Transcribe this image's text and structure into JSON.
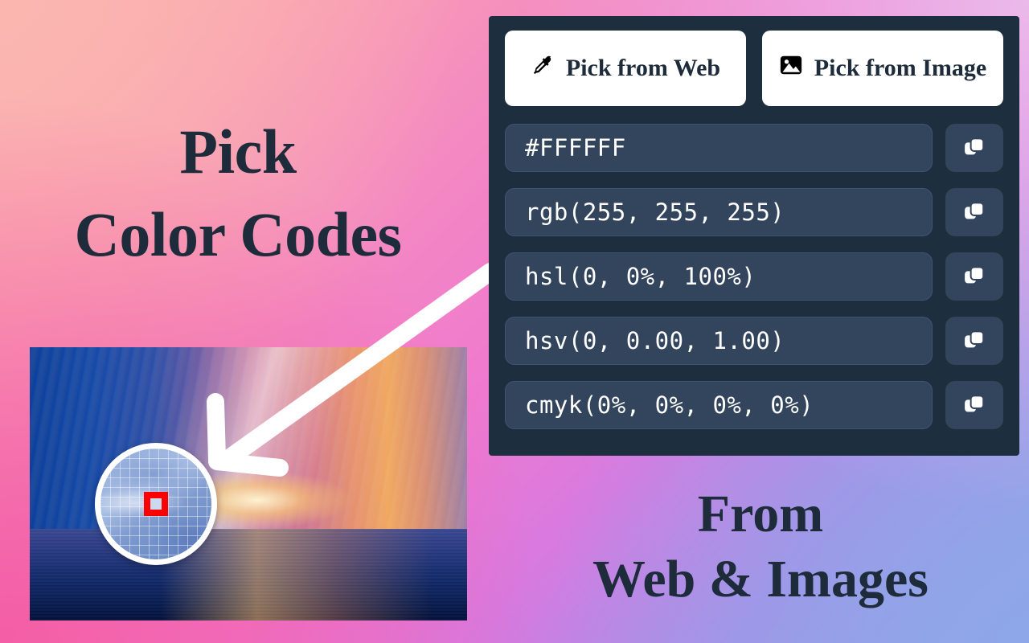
{
  "background": {
    "gradient_colors": [
      "#FBB6B0",
      "#ECBDEB",
      "#F45BA4",
      "#8EA7E8"
    ]
  },
  "headline": {
    "line1": "Pick",
    "line2": "Color Codes",
    "color": "#1D2B3A"
  },
  "tagline": {
    "line1": "From",
    "line2": "Web & Images",
    "color": "#1D2B3A"
  },
  "photo": {
    "alt": "sunset over ocean photograph"
  },
  "magnifier": {
    "target_outline_color": "#FF0000",
    "sampled_color": "#CCD9EF",
    "ring_color": "#FFFFFF"
  },
  "panel": {
    "background": "#1D2E3E",
    "buttons": [
      {
        "label": "Pick from Web",
        "icon": "eyedropper-icon"
      },
      {
        "label": "Pick from Image",
        "icon": "image-icon"
      }
    ],
    "rows": [
      {
        "format": "hex",
        "value": "#FFFFFF",
        "copy_label": "copy-icon"
      },
      {
        "format": "rgb",
        "value": "rgb(255, 255, 255)",
        "copy_label": "copy-icon"
      },
      {
        "format": "hsl",
        "value": "hsl(0, 0%, 100%)",
        "copy_label": "copy-icon"
      },
      {
        "format": "hsv",
        "value": "hsv(0, 0.00, 1.00)",
        "copy_label": "copy-icon"
      },
      {
        "format": "cmyk",
        "value": "cmyk(0%, 0%, 0%, 0%)",
        "copy_label": "copy-icon"
      }
    ],
    "field_background": "#33455C",
    "field_text_color": "#FFFFFF"
  }
}
